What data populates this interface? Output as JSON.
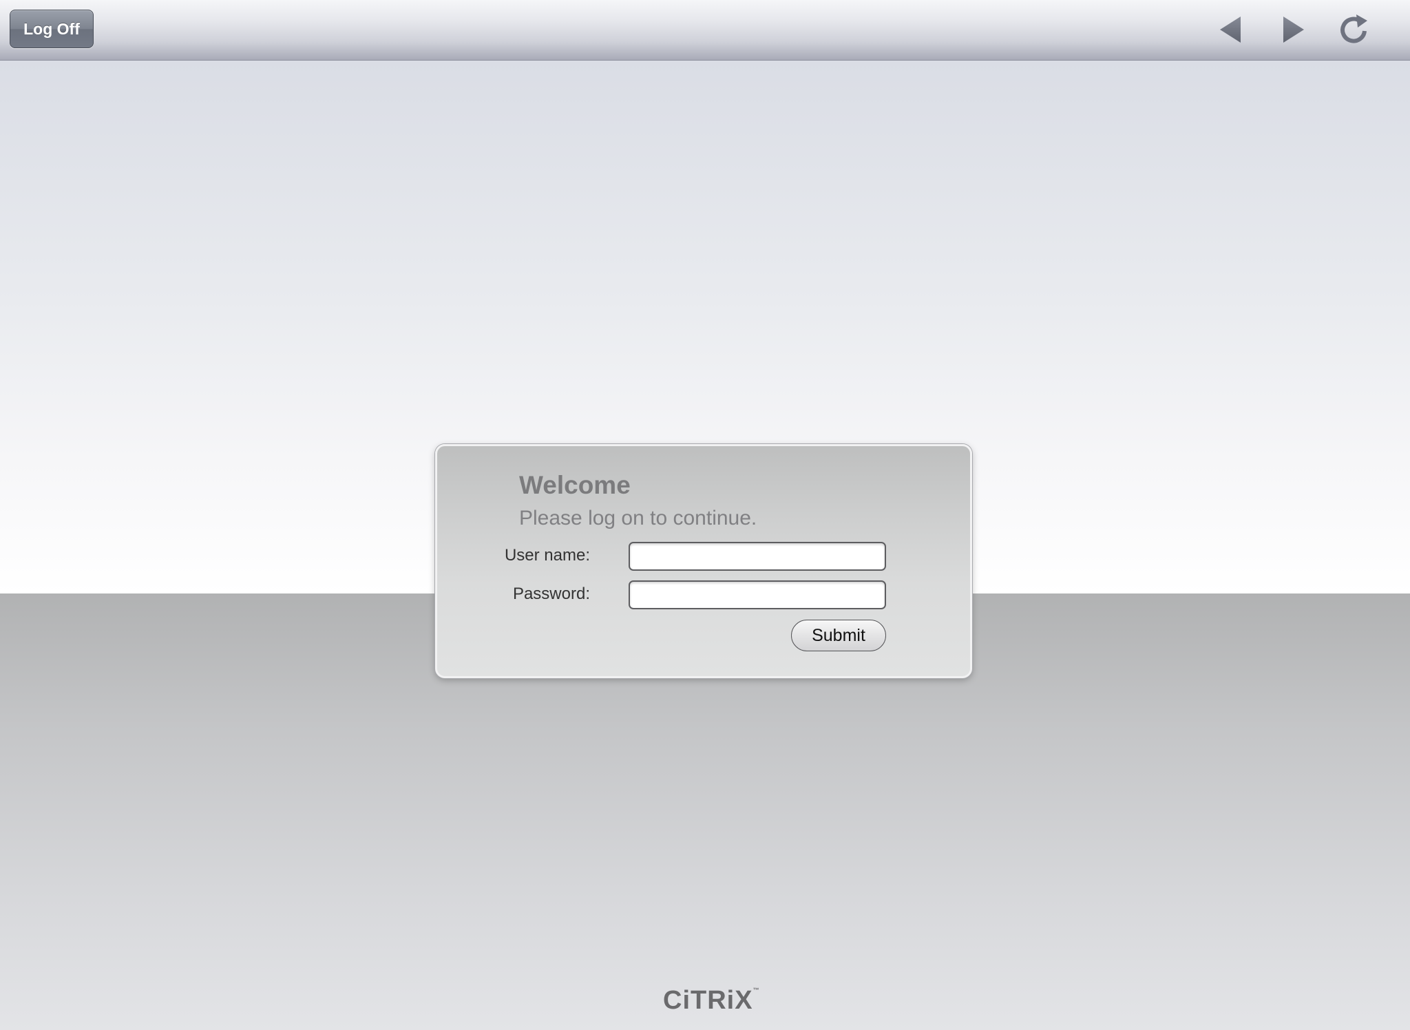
{
  "toolbar": {
    "logoff_label": "Log Off",
    "icons": [
      "back-arrow-icon",
      "forward-arrow-icon",
      "refresh-icon"
    ],
    "icon_color": "#6f7380"
  },
  "login": {
    "title": "Welcome",
    "subtitle": "Please log on to continue.",
    "username_label": "User name:",
    "username_value": "",
    "password_label": "Password:",
    "password_value": "",
    "submit_label": "Submit"
  },
  "footer": {
    "logo_text": "CiTRiX",
    "logo_mark": "™"
  },
  "colors": {
    "panel": "#d5d6d6",
    "title_text": "#7b7b7d",
    "logo": "#6a6a6c"
  }
}
